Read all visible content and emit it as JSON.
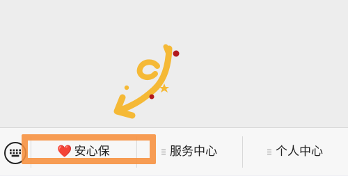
{
  "menu": {
    "items": [
      {
        "label": "安心保",
        "icon": "heart-icon",
        "glyph": "❤️"
      },
      {
        "label": "服务中心",
        "icon": "submenu-icon"
      },
      {
        "label": "个人中心",
        "icon": "submenu-icon"
      }
    ],
    "keyboard_toggle": {
      "icon": "keyboard-icon"
    }
  },
  "annotation": {
    "highlight_color": "#f78f3c",
    "arrow_color": "#f5b936",
    "dot_color": "#b2191e"
  }
}
